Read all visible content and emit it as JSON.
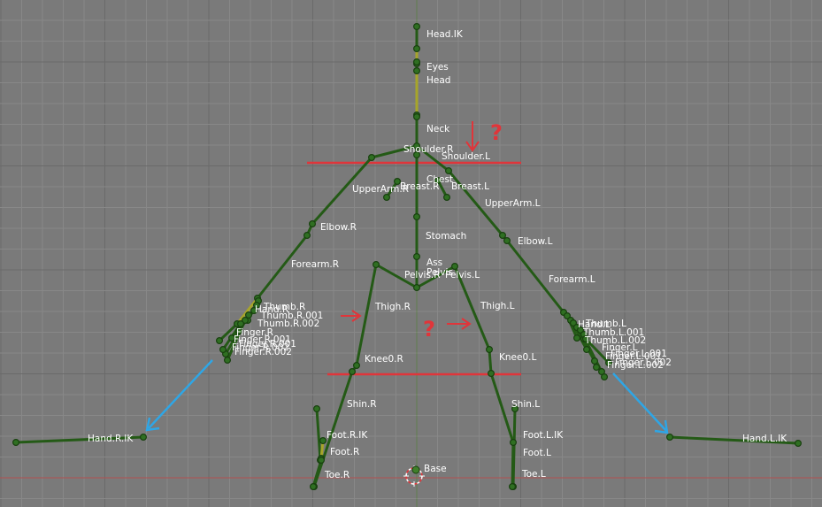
{
  "viewport": {
    "background": "#7a7a7a",
    "grid_minor": "#888888",
    "grid_major": "#6a6a6a",
    "horizon_axis": "#b15050",
    "vertical_axis": "#5a8c3a"
  },
  "colors": {
    "bone": "#245a16",
    "bone_selected": "#a7a52a",
    "joint": "#2f6f22",
    "annotation_red": "#e0353a",
    "annotation_blue": "#2ea6e6",
    "label": "#ffffff"
  },
  "bone_labels": {
    "head_ik": "Head.IK",
    "eyes": "Eyes",
    "head": "Head",
    "neck": "Neck",
    "shoulder_r": "Shoulder.R",
    "shoulder_l": "Shoulder.L",
    "chest": "Chest",
    "breast_r": "Breast.R",
    "breast_l": "Breast.L",
    "upperarm_r": "UpperArm.R",
    "upperarm_l": "UpperArm.L",
    "elbow_r": "Elbow.R",
    "elbow_l": "Elbow.L",
    "stomach": "Stomach",
    "ass": "Ass",
    "pelvis": "Pelvis",
    "pelvis_r": "Pelvis.R",
    "pelvis_l": "Pelvis.L",
    "forearm_r": "Forearm.R",
    "forearm_l": "Forearm.L",
    "thigh_r": "Thigh.R",
    "thigh_l": "Thigh.L",
    "hand_r": "Hand.R",
    "thumb_r": "Thumb.R",
    "thumb_r_001": "Thumb.R.001",
    "thumb_r_002": "Thumb.R.002",
    "hand_l": "Hand.L",
    "thumb_l": "Thumb.L",
    "thumb_l_001": "Thumb.L.001",
    "thumb_l_002": "Thumb.L.002",
    "fingers_r_a": "Finger.R",
    "fingers_r_b": "Finger.R.001",
    "fingers_r_c": "Finger.R.002",
    "fingers_l_a": "Finger.L",
    "fingers_l_b": "Finger.L.001",
    "fingers_l_c": "Finger.L.002",
    "knee0_r": "Knee0.R",
    "knee0_l": "Knee0.L",
    "shin_r": "Shin.R",
    "shin_l": "Shin.L",
    "hand_r_ik": "Hand.R.IK",
    "hand_l_ik": "Hand.L.IK",
    "foot_r_ik": "Foot.R.IK",
    "foot_l_ik": "Foot.L.IK",
    "foot_r": "Foot.R",
    "foot_l": "Foot.L",
    "toe_r": "Toe.R",
    "toe_l": "Toe.L",
    "base": "Base"
  },
  "annotations": {
    "question_mark": "?"
  }
}
